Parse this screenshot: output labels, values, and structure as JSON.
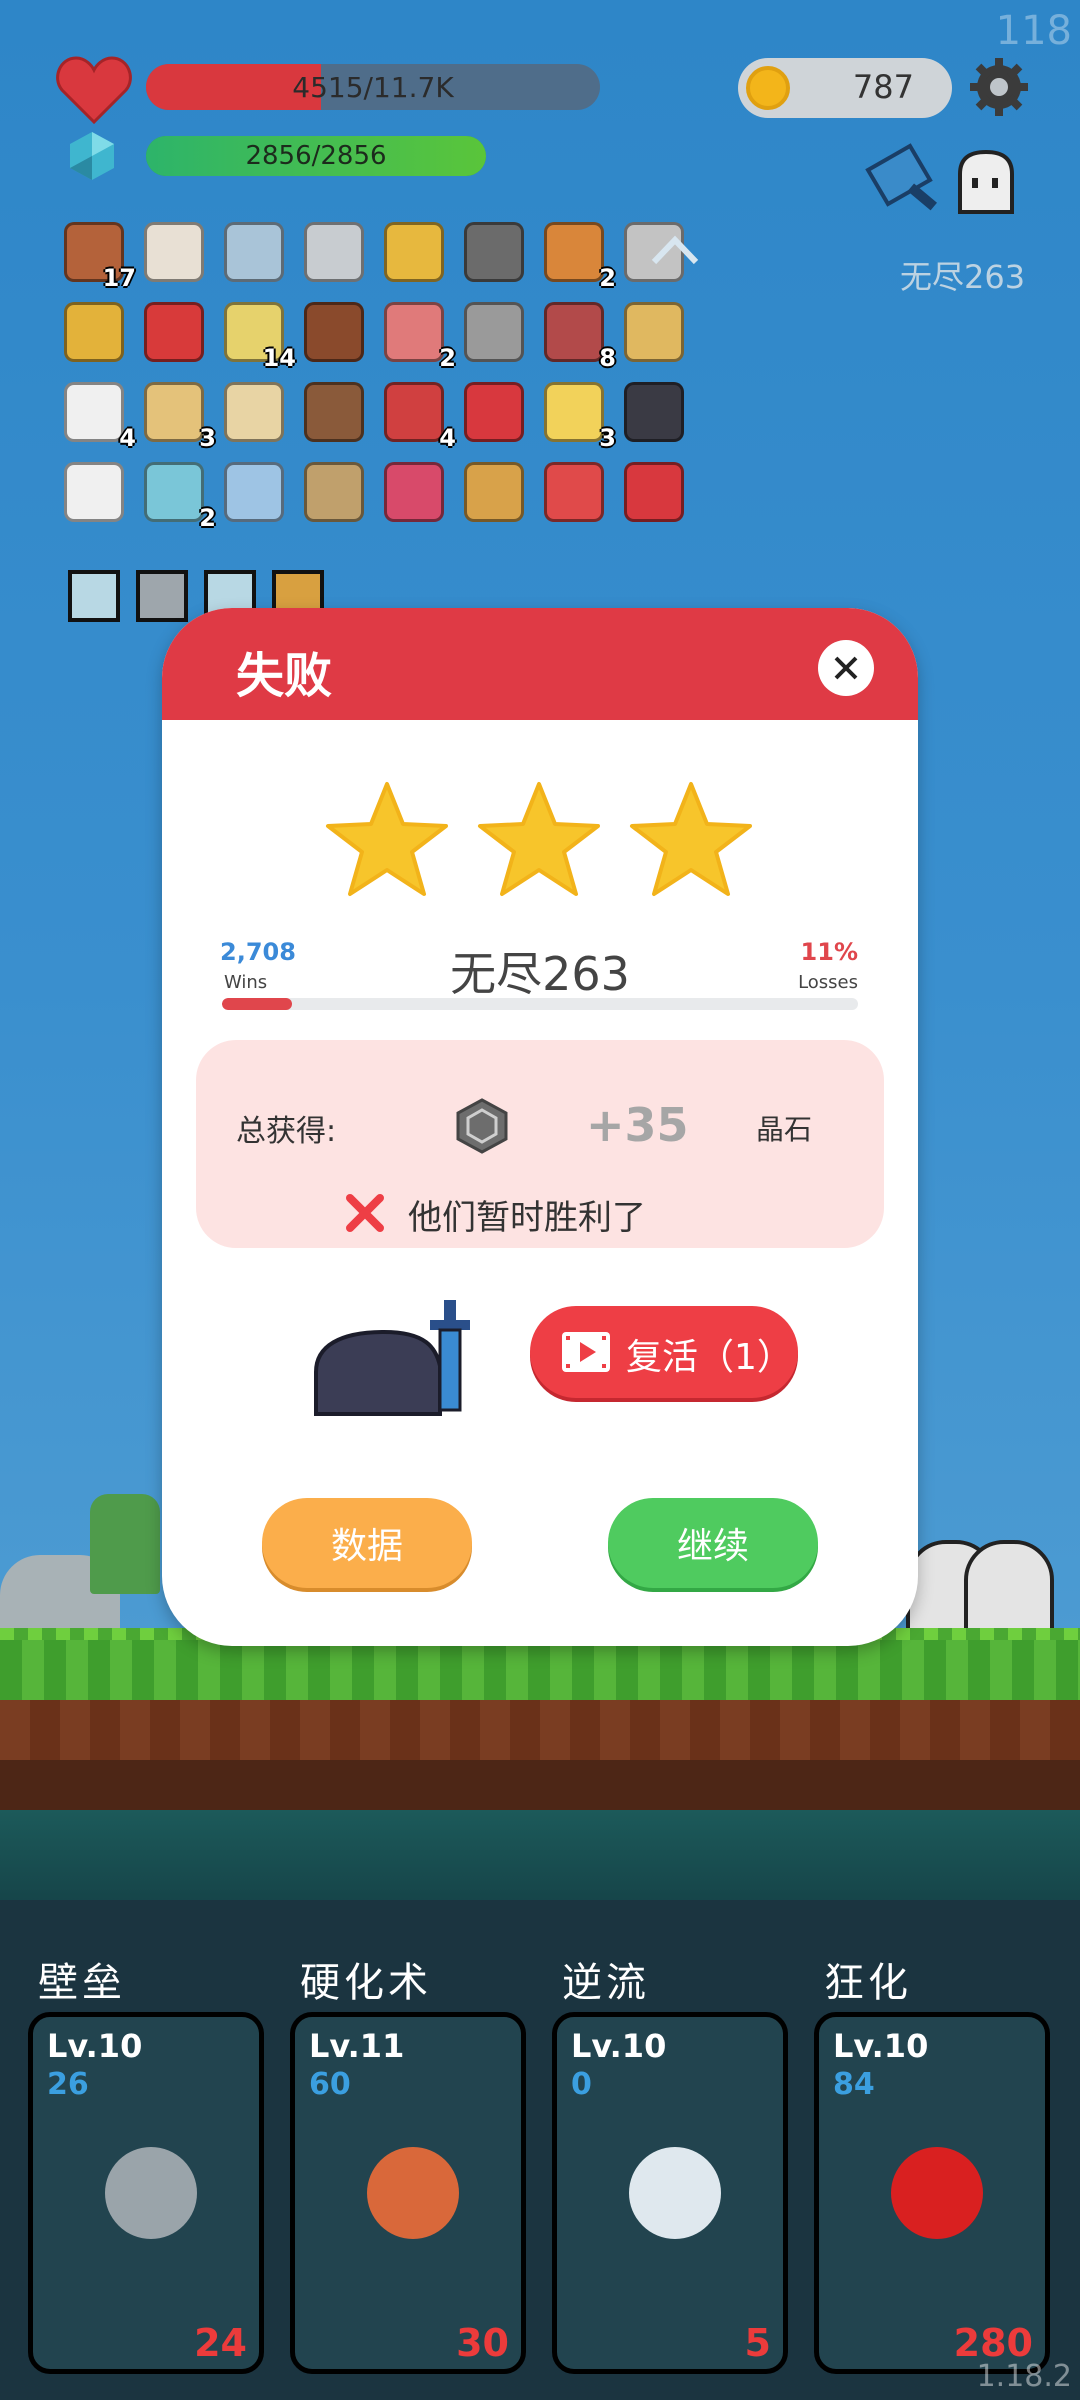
{
  "corner_number": "118",
  "version": "1.18.2",
  "player": {
    "hp_text": "4515/11.7K",
    "hp_fraction": 0.385,
    "mp_text": "2856/2856",
    "mp_fraction": 1.0,
    "coins": "787"
  },
  "stage_label": "无尽263",
  "items": [
    {
      "icon": "shield-icon",
      "count": "17"
    },
    {
      "icon": "gauntlet-icon",
      "count": ""
    },
    {
      "icon": "cloth-icon",
      "count": ""
    },
    {
      "icon": "sword-icon",
      "count": ""
    },
    {
      "icon": "ring-icon",
      "count": ""
    },
    {
      "icon": "mace-icon",
      "count": ""
    },
    {
      "icon": "meteor-icon",
      "count": "2"
    },
    {
      "icon": "viking-helmet-icon",
      "count": ""
    },
    {
      "icon": "egg-icon",
      "count": ""
    },
    {
      "icon": "strawberry-icon",
      "count": ""
    },
    {
      "icon": "battery-icon",
      "count": "14"
    },
    {
      "icon": "mushroom-icon",
      "count": ""
    },
    {
      "icon": "pill-icon",
      "count": "2"
    },
    {
      "icon": "axe-icon",
      "count": ""
    },
    {
      "icon": "tombstone-icon",
      "count": "8"
    },
    {
      "icon": "scroll-icon",
      "count": ""
    },
    {
      "icon": "dice-icon",
      "count": "4"
    },
    {
      "icon": "map-icon",
      "count": "3"
    },
    {
      "icon": "treasure-map-icon",
      "count": ""
    },
    {
      "icon": "potion-icon",
      "count": ""
    },
    {
      "icon": "sock-icon",
      "count": "4"
    },
    {
      "icon": "heart-icon",
      "count": ""
    },
    {
      "icon": "cheese-icon",
      "count": "3"
    },
    {
      "icon": "skull-book-icon",
      "count": ""
    },
    {
      "icon": "checklist-icon",
      "count": ""
    },
    {
      "icon": "syringe-icon",
      "count": "2"
    },
    {
      "icon": "shirt-icon",
      "count": ""
    },
    {
      "icon": "bow-icon",
      "count": ""
    },
    {
      "icon": "jam-jar-icon",
      "count": ""
    },
    {
      "icon": "book-icon",
      "count": ""
    },
    {
      "icon": "sneaker-icon",
      "count": ""
    },
    {
      "icon": "heat-waves-icon",
      "count": ""
    }
  ],
  "buffs": [
    "light-buff-icon",
    "armor-buff-icon",
    "light-buff-icon",
    "dark-buff-icon"
  ],
  "dialog": {
    "title": "失败",
    "stars": 3,
    "wins_count": "2,708",
    "wins_label": "Wins",
    "stage": "无尽263",
    "loss_percent": "11%",
    "loss_label": "Losses",
    "loss_fraction": 0.11,
    "reward_label": "总获得:",
    "reward_amount": "+35",
    "reward_unit": "晶石",
    "result_text": "他们暂时胜利了",
    "revive_label": "复活（1）",
    "stats_label": "数据",
    "continue_label": "继续"
  },
  "skills": [
    {
      "name": "壁垒",
      "level": "Lv.10",
      "value": "26",
      "cost": "24",
      "icon": "armor-icon"
    },
    {
      "name": "硬化术",
      "level": "Lv.11",
      "value": "60",
      "cost": "30",
      "icon": "vase-icon"
    },
    {
      "name": "逆流",
      "level": "Lv.10",
      "value": "0",
      "cost": "5",
      "icon": "wind-icon"
    },
    {
      "name": "狂化",
      "level": "Lv.10",
      "value": "84",
      "cost": "280",
      "icon": "rage-splat-icon"
    }
  ],
  "colors": {
    "hp": "#d9383e",
    "mp": "#2db46a",
    "header": "#df3a45",
    "revive": "#ee3e45",
    "stats": "#fbae4b",
    "continue": "#4fcb5f"
  }
}
